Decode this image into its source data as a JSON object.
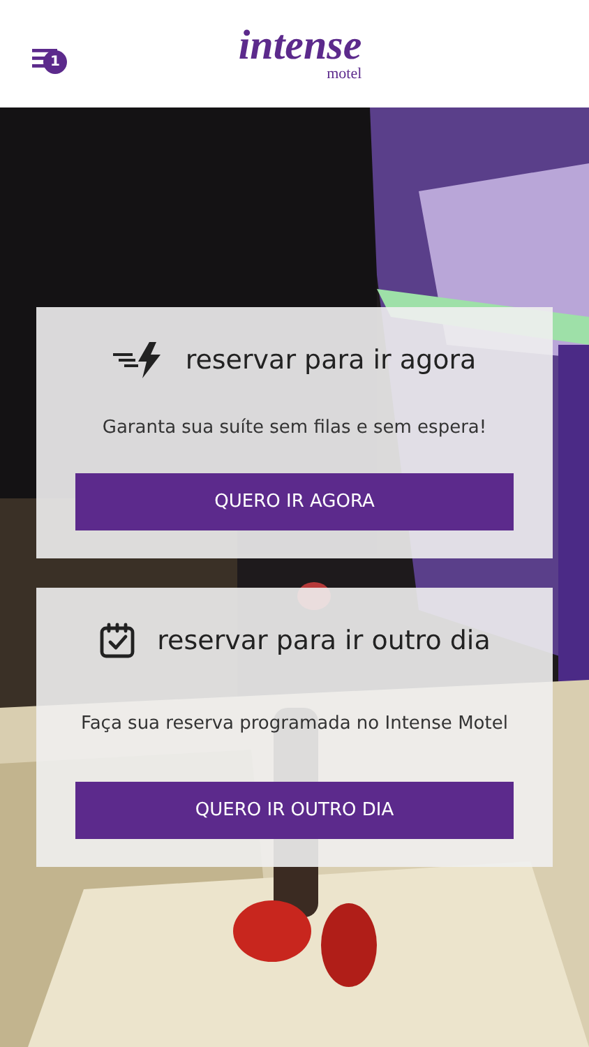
{
  "header": {
    "menu_badge": "1",
    "logo": "intense",
    "logo_sub": "motel"
  },
  "cards": [
    {
      "kind": "now",
      "title": "reservar para ir agora",
      "text": "Garanta sua suíte sem filas e sem espera!",
      "button": "QUERO IR AGORA"
    },
    {
      "kind": "later",
      "title": "reservar para ir outro dia",
      "text": "Faça sua reserva programada no Intense Motel",
      "button": "QUERO IR OUTRO DIA"
    }
  ]
}
